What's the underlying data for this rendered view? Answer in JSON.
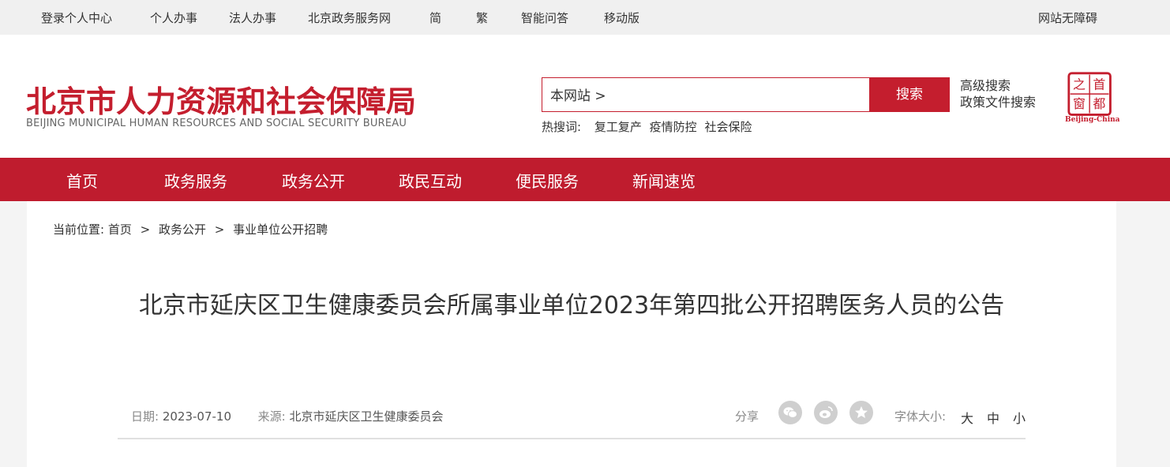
{
  "topbar": {
    "login": "登录个人中心",
    "personal": "个人办事",
    "legal": "法人办事",
    "gov_network": "北京政务服务网",
    "simplified": "简",
    "traditional": "繁",
    "smart_qa": "智能问答",
    "mobile": "移动版",
    "accessibility": "网站无障碍"
  },
  "header": {
    "logo_cn": "北京市人力资源和社会保障局",
    "logo_en": "BEIJING MUNICIPAL HUMAN RESOURCES AND SOCIAL SECURITY BUREAU",
    "search_scope": "本网站 >",
    "search_button": "搜索",
    "advanced_search": "高级搜索",
    "policy_search": "政策文件搜索",
    "hot_label": "热搜词:",
    "hot_words": [
      "复工复产",
      "疫情防控",
      "社会保险"
    ],
    "seal_chars": [
      "首",
      "都",
      "之",
      "窗"
    ],
    "seal_caption": "Beijing-China"
  },
  "nav": {
    "items": [
      "首页",
      "政务服务",
      "政务公开",
      "政民互动",
      "便民服务",
      "新闻速览"
    ]
  },
  "breadcrumb": {
    "lead": "当前位置:",
    "items": [
      "首页",
      "政务公开",
      "事业单位公开招聘"
    ],
    "separator": ">"
  },
  "article": {
    "title": "北京市延庆区卫生健康委员会所属事业单位2023年第四批公开招聘医务人员的公告",
    "date_label": "日期:",
    "date": "2023-07-10",
    "source_label": "来源:",
    "source": "北京市延庆区卫生健康委员会",
    "share_label": "分享",
    "font_label": "字体大小:",
    "font_sizes": [
      "大",
      "中",
      "小"
    ]
  },
  "colors": {
    "brand_red": "#c41e2e",
    "nav_red": "#bf1c2e"
  },
  "icons": {
    "share": [
      "wechat-icon",
      "weibo-icon",
      "favorite-icon"
    ]
  }
}
